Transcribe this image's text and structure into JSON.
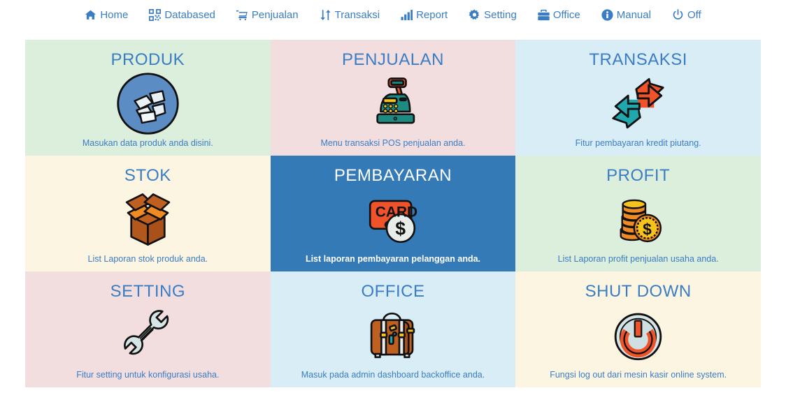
{
  "nav": {
    "items": [
      {
        "label": "Home",
        "icon": "home-icon"
      },
      {
        "label": "Databased",
        "icon": "qrcode-icon"
      },
      {
        "label": "Penjualan",
        "icon": "shopping-cart-icon"
      },
      {
        "label": "Transaksi",
        "icon": "exchange-vertical-icon"
      },
      {
        "label": "Report",
        "icon": "bar-chart-icon"
      },
      {
        "label": "Setting",
        "icon": "gear-icon"
      },
      {
        "label": "Office",
        "icon": "briefcase-icon"
      },
      {
        "label": "Manual",
        "icon": "info-circle-icon"
      },
      {
        "label": "Off",
        "icon": "power-icon"
      }
    ]
  },
  "colors": {
    "accent_blue": "#3b7dc4",
    "active_card_bg": "#337ab7",
    "card_green": "#dceedc",
    "card_pink": "#f2dedf",
    "card_blue": "#d9edf7",
    "card_cream": "#fcf5e2"
  },
  "grid": {
    "cards": [
      {
        "title": "PRODUK",
        "desc": "Masukan data produk anda disini.",
        "bg": "#dceedc",
        "icon": "product-box-icon",
        "active": false
      },
      {
        "title": "PENJUALAN",
        "desc": "Menu transaksi POS penjualan anda.",
        "bg": "#f2dedf",
        "icon": "cash-register-icon",
        "active": false
      },
      {
        "title": "TRANSAKSI",
        "desc": "Fitur pembayaran kredit piutang.",
        "bg": "#d9edf7",
        "icon": "exchange-arrows-icon",
        "active": false
      },
      {
        "title": "STOK",
        "desc": "List Laporan stok produk anda.",
        "bg": "#fcf5e2",
        "icon": "cardboard-box-icon",
        "active": false
      },
      {
        "title": "PEMBAYARAN",
        "desc": "List laporan pembayaran pelanggan anda.",
        "bg": "#337ab7",
        "icon": "credit-card-coin-icon",
        "active": true
      },
      {
        "title": "PROFIT",
        "desc": "List Laporan profit penjualan usaha anda.",
        "bg": "#dceedc",
        "icon": "coin-stack-icon",
        "active": false
      },
      {
        "title": "SETTING",
        "desc": "Fitur setting untuk konfigurasi usaha.",
        "bg": "#f2dedf",
        "icon": "wrench-icon",
        "active": false
      },
      {
        "title": "OFFICE",
        "desc": "Masuk pada admin dashboard backoffice anda.",
        "bg": "#d9edf7",
        "icon": "suitcase-icon",
        "active": false
      },
      {
        "title": "SHUT DOWN",
        "desc": "Fungsi log out dari mesin kasir online system.",
        "bg": "#fcf5e2",
        "icon": "power-button-icon",
        "active": false
      }
    ]
  }
}
